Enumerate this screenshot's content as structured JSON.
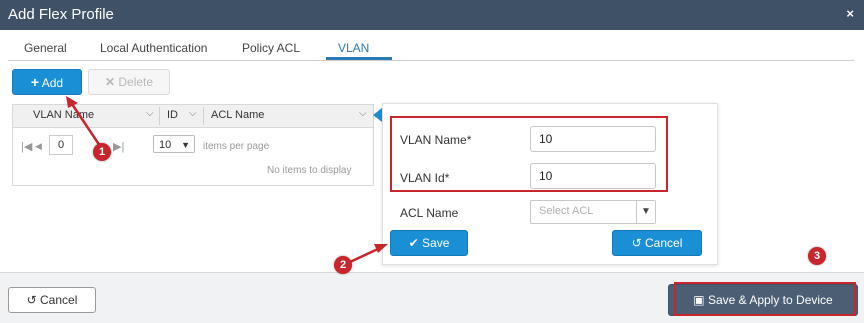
{
  "dialog": {
    "title": "Add Flex Profile",
    "close_symbol": "×"
  },
  "tabs": [
    {
      "label": "General",
      "active": false
    },
    {
      "label": "Local Authentication",
      "active": false
    },
    {
      "label": "Policy ACL",
      "active": false
    },
    {
      "label": "VLAN",
      "active": true
    }
  ],
  "toolbar": {
    "add_label": "Add",
    "delete_label": "Delete"
  },
  "grid": {
    "columns": [
      "VLAN Name",
      "ID",
      "ACL Name"
    ],
    "pager": {
      "page": "0",
      "per_page": "10",
      "per_page_label": "items per page"
    },
    "empty_text": "No items to display"
  },
  "form": {
    "vlan_name_label": "VLAN Name*",
    "vlan_name_value": "10",
    "vlan_id_label": "VLAN Id*",
    "vlan_id_value": "10",
    "acl_name_label": "ACL Name",
    "acl_placeholder": "Select ACL",
    "save_label": "Save",
    "cancel_label": "Cancel"
  },
  "footer": {
    "cancel_label": "Cancel",
    "save_apply_label": "Save & Apply to Device"
  },
  "annotations": {
    "marker_1": "1",
    "marker_2": "2",
    "marker_3": "3"
  },
  "colors": {
    "title_bar": "#3f5167",
    "primary": "#1b8fd6",
    "highlight": "#c8252c",
    "tab_active": "#2a7ab8"
  }
}
